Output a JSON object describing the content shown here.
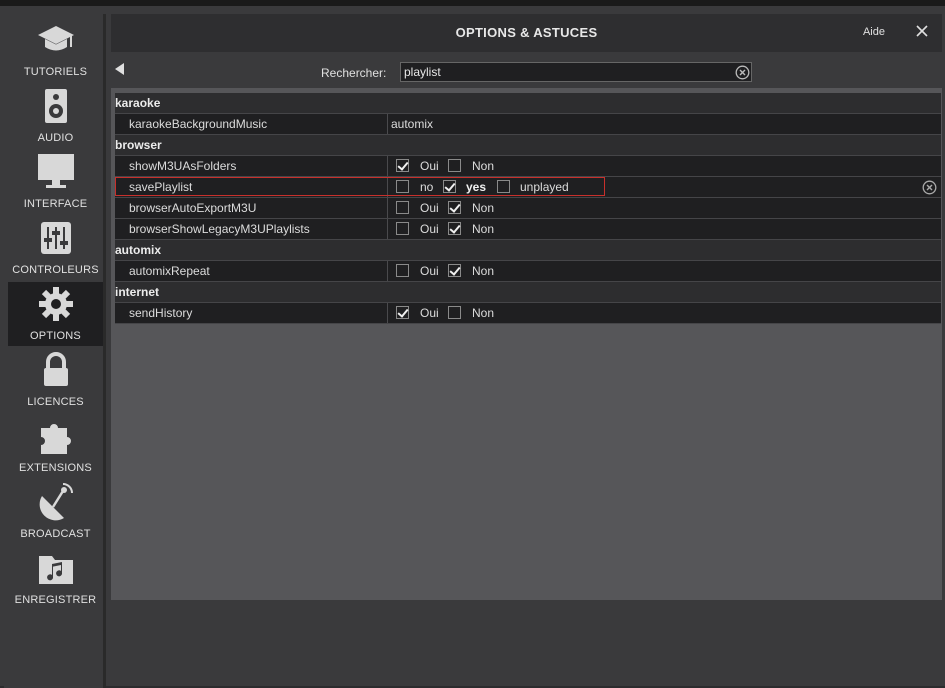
{
  "window": {
    "title": "OPTIONS & ASTUCES",
    "help_label": "Aide"
  },
  "sidebar": {
    "items": [
      {
        "label": "TUTORIELS",
        "icon": "graduation-cap-icon"
      },
      {
        "label": "AUDIO",
        "icon": "speaker-icon"
      },
      {
        "label": "INTERFACE",
        "icon": "monitor-icon"
      },
      {
        "label": "CONTROLEURS",
        "icon": "sliders-icon"
      },
      {
        "label": "OPTIONS",
        "icon": "gear-icon",
        "active": true
      },
      {
        "label": "LICENCES",
        "icon": "lock-icon"
      },
      {
        "label": "EXTENSIONS",
        "icon": "puzzle-icon"
      },
      {
        "label": "BROADCAST",
        "icon": "satellite-dish-icon"
      },
      {
        "label": "ENREGISTRER",
        "icon": "music-folder-icon"
      }
    ]
  },
  "search": {
    "label": "Rechercher:",
    "value": "playlist"
  },
  "categories": {
    "karaoke": "karaoke",
    "browser": "browser",
    "automix": "automix",
    "internet": "internet"
  },
  "settings": {
    "karaokeBackgroundMusic": {
      "name": "karaokeBackgroundMusic",
      "value": "automix"
    },
    "showM3UAsFolders": {
      "name": "showM3UAsFolders",
      "opt1": "Oui",
      "opt2": "Non"
    },
    "savePlaylist": {
      "name": "savePlaylist",
      "opt1": "no",
      "opt2": "yes",
      "opt3": "unplayed"
    },
    "browserAutoExportM3U": {
      "name": "browserAutoExportM3U",
      "opt1": "Oui",
      "opt2": "Non"
    },
    "browserShowLegacyM3UPlaylists": {
      "name": "browserShowLegacyM3UPlaylists",
      "opt1": "Oui",
      "opt2": "Non"
    },
    "automixRepeat": {
      "name": "automixRepeat",
      "opt1": "Oui",
      "opt2": "Non"
    },
    "sendHistory": {
      "name": "sendHistory",
      "opt1": "Oui",
      "opt2": "Non"
    }
  },
  "checked": {
    "showM3UAsFolders": "Oui",
    "savePlaylist": "yes",
    "browserAutoExportM3U": "Non",
    "browserShowLegacyM3UPlaylists": "Non",
    "automixRepeat": "Non",
    "sendHistory": "Oui"
  },
  "colors": {
    "highlight": "#c8302c",
    "active_nav_bg": "#1f1f21"
  }
}
